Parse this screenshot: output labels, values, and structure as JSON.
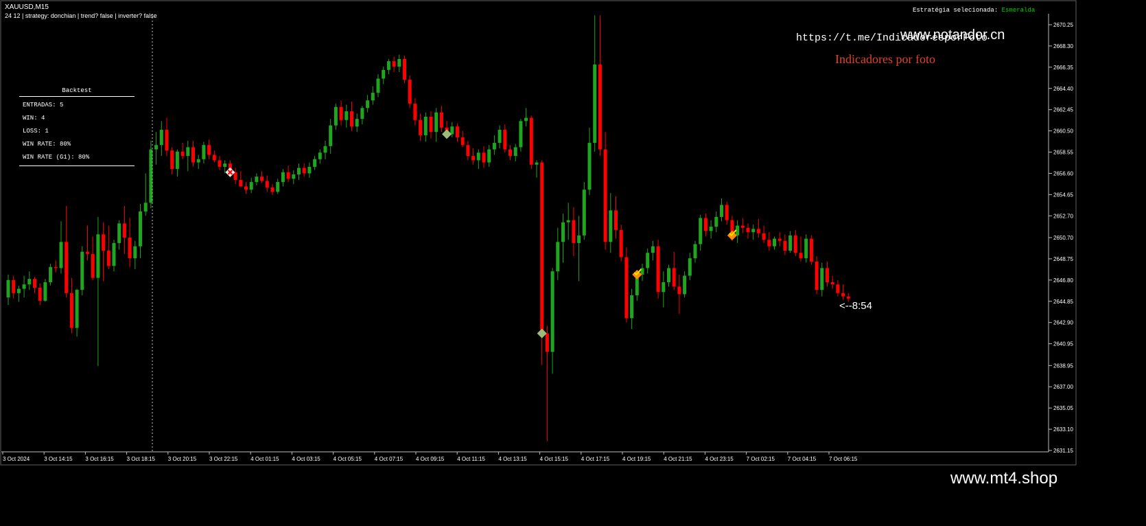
{
  "chart": {
    "symbol_title": "XAUUSD,M15",
    "info_line": "24 12 | strategy: donchian | trend? false | inverter? false",
    "strategy_label": "Estratégia selecionada:",
    "strategy_value": "Esmeralda",
    "telegram_link": "https://t.me/IndicadoresporFoto",
    "watermark_top": "www.notandor.cn",
    "watermark_bottom": "www.mt4.shop",
    "promo_text": "Indicadores por foto",
    "countdown": "<--8:54",
    "colors": {
      "background": "#000000",
      "bull": "#1fa51f",
      "bear": "#ff0000",
      "promo": "#e0412c",
      "strategy_value": "#00d000"
    }
  },
  "backtest": {
    "title": "Backtest",
    "rows": [
      "ENTRADAS: 5",
      "WIN: 4",
      "LOSS: 1",
      "WIN RATE: 80%",
      "WIN RATE (G1): 80%"
    ]
  },
  "chart_data": {
    "type": "candlestick",
    "title": "XAUUSD,M15",
    "price_ticks": [
      "2670.25",
      "2668.30",
      "2666.35",
      "2664.40",
      "2662.45",
      "2660.50",
      "2658.55",
      "2656.60",
      "2654.65",
      "2652.70",
      "2650.70",
      "2648.75",
      "2646.80",
      "2644.85",
      "2642.90",
      "2640.95",
      "2638.95",
      "2637.00",
      "2635.05",
      "2633.10",
      "2631.15"
    ],
    "time_ticks": [
      "3 Oct 2024",
      "3 Oct 14:15",
      "3 Oct 16:15",
      "3 Oct 18:15",
      "3 Oct 20:15",
      "3 Oct 22:15",
      "4 Oct 01:15",
      "4 Oct 03:15",
      "4 Oct 05:15",
      "4 Oct 07:15",
      "4 Oct 09:15",
      "4 Oct 11:15",
      "4 Oct 13:15",
      "4 Oct 15:15",
      "4 Oct 17:15",
      "4 Oct 19:15",
      "4 Oct 21:15",
      "4 Oct 23:15",
      "7 Oct 02:15",
      "7 Oct 04:15",
      "7 Oct 06:15"
    ],
    "ylim": [
      2631.15,
      2670.25
    ],
    "candles": [
      [
        2645.2,
        2647.3,
        2644.5,
        2646.8
      ],
      [
        2646.8,
        2647.2,
        2645.1,
        2645.6
      ],
      [
        2645.6,
        2646.3,
        2644.8,
        2646.0
      ],
      [
        2646.0,
        2647.2,
        2645.2,
        2646.4
      ],
      [
        2646.4,
        2647.6,
        2645.9,
        2646.9
      ],
      [
        2646.9,
        2647.1,
        2645.6,
        2646.1
      ],
      [
        2646.1,
        2646.5,
        2644.5,
        2644.9
      ],
      [
        2644.9,
        2646.9,
        2644.8,
        2646.6
      ],
      [
        2646.6,
        2648.3,
        2646.3,
        2648.0
      ],
      [
        2648.0,
        2648.6,
        2647.5,
        2647.9
      ],
      [
        2647.9,
        2652.2,
        2647.4,
        2650.3
      ],
      [
        2650.3,
        2653.6,
        2645.2,
        2645.6
      ],
      [
        2645.6,
        2647.0,
        2641.9,
        2642.4
      ],
      [
        2642.4,
        2646.0,
        2641.6,
        2645.9
      ],
      [
        2645.9,
        2649.9,
        2645.4,
        2649.4
      ],
      [
        2649.4,
        2651.8,
        2648.6,
        2649.2
      ],
      [
        2649.2,
        2650.8,
        2646.8,
        2647.0
      ],
      [
        2647.0,
        2652.6,
        2638.9,
        2651.0
      ],
      [
        2651.0,
        2652.1,
        2646.7,
        2649.5
      ],
      [
        2649.5,
        2651.8,
        2647.8,
        2648.1
      ],
      [
        2648.1,
        2650.5,
        2647.6,
        2650.2
      ],
      [
        2650.2,
        2652.3,
        2649.6,
        2652.0
      ],
      [
        2652.0,
        2653.6,
        2649.2,
        2650.7
      ],
      [
        2650.7,
        2652.5,
        2648.0,
        2648.8
      ],
      [
        2648.8,
        2650.4,
        2647.8,
        2649.9
      ],
      [
        2649.9,
        2653.8,
        2648.8,
        2653.1
      ],
      [
        2653.1,
        2656.6,
        2652.7,
        2653.9
      ],
      [
        2653.9,
        2659.6,
        2653.4,
        2658.8
      ],
      [
        2658.8,
        2660.4,
        2657.4,
        2659.2
      ],
      [
        2659.2,
        2661.4,
        2658.2,
        2660.6
      ],
      [
        2660.6,
        2661.7,
        2658.2,
        2658.7
      ],
      [
        2658.7,
        2659.0,
        2656.5,
        2657.0
      ],
      [
        2657.0,
        2658.8,
        2656.3,
        2658.6
      ],
      [
        2658.6,
        2659.4,
        2657.9,
        2658.2
      ],
      [
        2658.2,
        2659.6,
        2656.8,
        2659.0
      ],
      [
        2659.0,
        2659.6,
        2657.2,
        2657.6
      ],
      [
        2657.6,
        2658.3,
        2657.0,
        2657.9
      ],
      [
        2657.9,
        2659.5,
        2657.5,
        2659.2
      ],
      [
        2659.2,
        2659.7,
        2657.9,
        2658.3
      ],
      [
        2658.3,
        2658.7,
        2657.6,
        2657.8
      ],
      [
        2657.8,
        2658.2,
        2656.9,
        2657.2
      ],
      [
        2657.2,
        2657.8,
        2656.6,
        2657.5
      ],
      [
        2657.5,
        2657.8,
        2656.3,
        2656.7
      ],
      [
        2656.7,
        2657.1,
        2655.6,
        2656.0
      ],
      [
        2656.0,
        2656.8,
        2655.3,
        2655.4
      ],
      [
        2655.4,
        2655.8,
        2654.7,
        2655.1
      ],
      [
        2655.1,
        2656.2,
        2654.8,
        2655.8
      ],
      [
        2655.8,
        2656.6,
        2655.5,
        2656.3
      ],
      [
        2656.3,
        2656.8,
        2655.7,
        2655.9
      ],
      [
        2655.9,
        2656.4,
        2654.9,
        2655.3
      ],
      [
        2655.3,
        2655.6,
        2654.6,
        2654.9
      ],
      [
        2654.9,
        2656.1,
        2654.7,
        2655.8
      ],
      [
        2655.8,
        2657.0,
        2655.4,
        2656.7
      ],
      [
        2656.7,
        2657.3,
        2655.8,
        2656.1
      ],
      [
        2656.1,
        2656.9,
        2655.6,
        2656.5
      ],
      [
        2656.5,
        2657.5,
        2656.0,
        2657.1
      ],
      [
        2657.1,
        2657.5,
        2656.3,
        2656.6
      ],
      [
        2656.6,
        2657.6,
        2656.2,
        2657.2
      ],
      [
        2657.2,
        2658.2,
        2656.9,
        2657.9
      ],
      [
        2657.9,
        2658.8,
        2657.5,
        2658.5
      ],
      [
        2658.5,
        2659.6,
        2657.9,
        2659.1
      ],
      [
        2659.1,
        2661.6,
        2658.4,
        2661.0
      ],
      [
        2661.0,
        2663.0,
        2660.6,
        2662.7
      ],
      [
        2662.7,
        2663.3,
        2661.0,
        2661.5
      ],
      [
        2661.5,
        2662.9,
        2660.8,
        2662.3
      ],
      [
        2662.3,
        2663.2,
        2660.5,
        2660.9
      ],
      [
        2660.9,
        2662.1,
        2660.4,
        2661.6
      ],
      [
        2661.6,
        2662.8,
        2661.1,
        2662.6
      ],
      [
        2662.6,
        2663.8,
        2662.2,
        2663.3
      ],
      [
        2663.3,
        2664.6,
        2662.9,
        2664.0
      ],
      [
        2664.0,
        2665.7,
        2663.6,
        2665.3
      ],
      [
        2665.3,
        2666.4,
        2664.8,
        2666.1
      ],
      [
        2666.1,
        2667.1,
        2665.7,
        2666.9
      ],
      [
        2666.9,
        2667.3,
        2665.9,
        2666.4
      ],
      [
        2666.4,
        2667.5,
        2665.9,
        2667.1
      ],
      [
        2667.1,
        2667.4,
        2664.9,
        2665.2
      ],
      [
        2665.2,
        2665.6,
        2662.6,
        2663.0
      ],
      [
        2663.0,
        2663.5,
        2661.0,
        2661.5
      ],
      [
        2661.5,
        2662.1,
        2659.6,
        2660.1
      ],
      [
        2660.1,
        2662.2,
        2659.5,
        2661.8
      ],
      [
        2661.8,
        2662.3,
        2659.8,
        2660.4
      ],
      [
        2660.4,
        2662.6,
        2659.5,
        2662.2
      ],
      [
        2662.2,
        2662.8,
        2660.4,
        2660.8
      ],
      [
        2660.8,
        2661.4,
        2659.8,
        2660.2
      ],
      [
        2660.2,
        2661.3,
        2659.9,
        2660.9
      ],
      [
        2660.9,
        2661.2,
        2659.5,
        2659.9
      ],
      [
        2659.9,
        2660.5,
        2659.0,
        2659.2
      ],
      [
        2659.2,
        2659.6,
        2657.8,
        2658.2
      ],
      [
        2658.2,
        2658.9,
        2657.4,
        2657.8
      ],
      [
        2657.8,
        2658.8,
        2657.0,
        2658.5
      ],
      [
        2658.5,
        2659.1,
        2657.1,
        2657.6
      ],
      [
        2657.6,
        2659.2,
        2657.2,
        2658.8
      ],
      [
        2658.8,
        2660.1,
        2658.3,
        2659.4
      ],
      [
        2659.4,
        2661.0,
        2658.9,
        2660.6
      ],
      [
        2660.6,
        2661.1,
        2658.5,
        2658.8
      ],
      [
        2658.8,
        2659.2,
        2657.8,
        2658.2
      ],
      [
        2658.2,
        2659.3,
        2657.7,
        2659.0
      ],
      [
        2659.0,
        2661.6,
        2658.6,
        2661.4
      ],
      [
        2661.4,
        2662.6,
        2660.9,
        2661.7
      ],
      [
        2661.7,
        2661.9,
        2657.0,
        2657.4
      ],
      [
        2657.4,
        2657.8,
        2656.2,
        2657.6
      ],
      [
        2657.6,
        2657.8,
        2639.0,
        2641.9
      ],
      [
        2641.9,
        2642.6,
        2632.0,
        2640.2
      ],
      [
        2640.2,
        2647.9,
        2638.2,
        2647.6
      ],
      [
        2647.6,
        2651.6,
        2646.8,
        2650.3
      ],
      [
        2650.3,
        2652.9,
        2648.4,
        2652.1
      ],
      [
        2652.1,
        2653.9,
        2650.5,
        2652.3
      ],
      [
        2652.3,
        2653.5,
        2649.0,
        2650.2
      ],
      [
        2650.2,
        2652.7,
        2646.7,
        2650.9
      ],
      [
        2650.9,
        2655.8,
        2650.5,
        2655.1
      ],
      [
        2655.1,
        2660.8,
        2654.6,
        2659.4
      ],
      [
        2659.4,
        2671.1,
        2658.6,
        2666.6
      ],
      [
        2666.6,
        2671.1,
        2658.2,
        2658.8
      ],
      [
        2658.8,
        2660.4,
        2649.6,
        2650.3
      ],
      [
        2650.3,
        2654.8,
        2649.3,
        2653.2
      ],
      [
        2653.2,
        2654.5,
        2650.6,
        2651.4
      ],
      [
        2651.4,
        2651.9,
        2648.5,
        2648.9
      ],
      [
        2648.9,
        2649.8,
        2642.9,
        2643.3
      ],
      [
        2643.3,
        2646.0,
        2642.3,
        2645.4
      ],
      [
        2645.4,
        2647.6,
        2644.9,
        2647.3
      ],
      [
        2647.3,
        2648.3,
        2646.7,
        2647.9
      ],
      [
        2647.9,
        2649.7,
        2647.4,
        2649.3
      ],
      [
        2649.3,
        2650.4,
        2648.6,
        2649.9
      ],
      [
        2649.9,
        2650.5,
        2645.1,
        2645.7
      ],
      [
        2645.7,
        2647.6,
        2644.3,
        2646.6
      ],
      [
        2646.6,
        2648.2,
        2646.2,
        2647.9
      ],
      [
        2647.9,
        2649.4,
        2645.9,
        2646.2
      ],
      [
        2646.2,
        2647.3,
        2643.7,
        2645.5
      ],
      [
        2645.5,
        2647.6,
        2645.2,
        2647.2
      ],
      [
        2647.2,
        2649.3,
        2646.8,
        2648.8
      ],
      [
        2648.8,
        2650.4,
        2648.4,
        2650.1
      ],
      [
        2650.1,
        2652.8,
        2649.5,
        2652.5
      ],
      [
        2652.5,
        2652.9,
        2650.8,
        2651.3
      ],
      [
        2651.3,
        2652.3,
        2650.6,
        2651.7
      ],
      [
        2651.7,
        2653.1,
        2651.2,
        2652.6
      ],
      [
        2652.6,
        2654.3,
        2652.2,
        2653.7
      ],
      [
        2653.7,
        2654.0,
        2651.9,
        2652.3
      ],
      [
        2652.3,
        2652.7,
        2650.4,
        2650.9
      ],
      [
        2650.9,
        2652.3,
        2650.2,
        2651.8
      ],
      [
        2651.8,
        2652.5,
        2651.1,
        2651.6
      ],
      [
        2651.6,
        2652.0,
        2650.6,
        2651.2
      ],
      [
        2651.2,
        2651.9,
        2650.5,
        2651.5
      ],
      [
        2651.5,
        2652.4,
        2650.7,
        2651.1
      ],
      [
        2651.1,
        2651.8,
        2650.2,
        2650.5
      ],
      [
        2650.5,
        2651.2,
        2649.5,
        2649.9
      ],
      [
        2649.9,
        2650.8,
        2649.6,
        2650.6
      ],
      [
        2650.6,
        2651.2,
        2649.9,
        2650.4
      ],
      [
        2650.4,
        2651.0,
        2649.1,
        2649.5
      ],
      [
        2649.5,
        2651.3,
        2649.3,
        2650.9
      ],
      [
        2650.9,
        2651.4,
        2649.0,
        2649.3
      ],
      [
        2649.3,
        2650.8,
        2648.5,
        2648.8
      ],
      [
        2648.8,
        2651.0,
        2648.4,
        2650.6
      ],
      [
        2650.6,
        2650.9,
        2648.2,
        2648.5
      ],
      [
        2648.5,
        2649.0,
        2645.5,
        2645.9
      ],
      [
        2645.9,
        2648.4,
        2645.3,
        2647.9
      ],
      [
        2647.9,
        2648.5,
        2646.2,
        2646.6
      ],
      [
        2646.6,
        2647.2,
        2646.0,
        2646.4
      ],
      [
        2646.4,
        2646.8,
        2645.3,
        2645.6
      ],
      [
        2645.6,
        2646.4,
        2645.0,
        2645.3
      ],
      [
        2645.3,
        2645.6,
        2644.8,
        2645.1
      ]
    ],
    "signals": [
      {
        "candle": 42,
        "color": "#e8e8e8",
        "result": "loss"
      },
      {
        "candle": 83,
        "color": "#9bbb7a",
        "result": "win"
      },
      {
        "candle": 101,
        "color": "#9bbb7a",
        "result": "win"
      },
      {
        "candle": 119,
        "color": "#ff8c00",
        "result": "win"
      },
      {
        "candle": 137,
        "color": "#ff8c00",
        "result": "win"
      }
    ]
  }
}
